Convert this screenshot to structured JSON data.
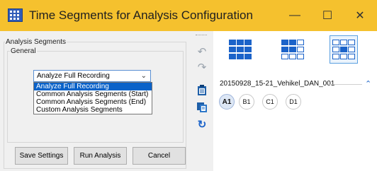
{
  "window": {
    "title": "Time Segments for Analysis Configuration",
    "minimize_glyph": "—",
    "maximize_glyph": "☐",
    "close_glyph": "✕",
    "titlebar_color": "#f5c12e"
  },
  "left_panel": {
    "group_title": "Analysis Segments",
    "subgroup_title": "General",
    "combo": {
      "selected": "Analyze Full Recording",
      "options": [
        "Analyze Full Recording",
        "Common Analysis Segments (Start)",
        "Common Analysis Segments (End)",
        "Custom Analysis Segments"
      ]
    },
    "buttons": {
      "save": "Save Settings",
      "run": "Run Analysis",
      "cancel": "Cancel"
    }
  },
  "toolbar": {
    "icons": [
      "undo-icon",
      "redo-icon",
      "paste-icon",
      "copy-icon",
      "refresh-icon"
    ]
  },
  "right_panel": {
    "layouts": [
      "layout-filled-grid-icon",
      "layout-mixed-grid-icon",
      "layout-outline-grid-icon"
    ],
    "recording_name": "20150928_15-21_Vehikel_DAN_001",
    "segments": [
      "A1",
      "B1",
      "C1",
      "D1"
    ],
    "active_segment": "A1",
    "accent_color": "#1b63c9"
  }
}
